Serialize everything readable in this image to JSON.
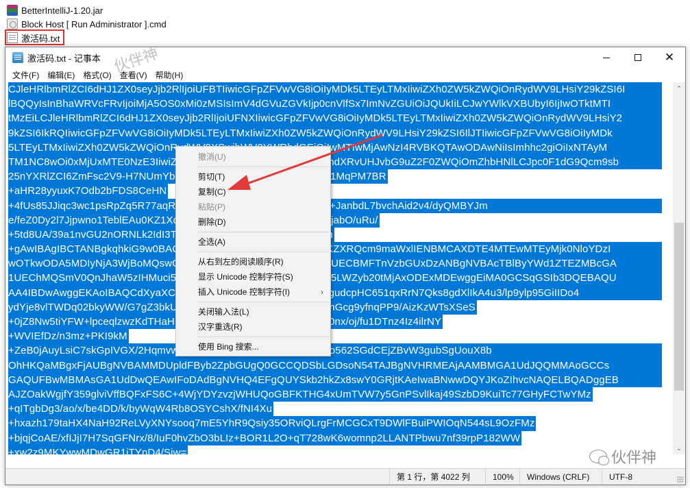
{
  "explorer": {
    "files": [
      {
        "name": "BetterIntelliJ-1.20.jar",
        "icon": "winrar-archive-icon"
      },
      {
        "name": "Block Host [ Run Administrator ].cmd",
        "icon": "cmd-script-icon"
      },
      {
        "name": "激活码.txt",
        "icon": "text-file-icon",
        "highlighted": true
      }
    ]
  },
  "window": {
    "title": "激活码.txt - 记事本",
    "controls": {
      "minimize": "—",
      "maximize": "□",
      "close": "✕"
    }
  },
  "menubar": {
    "items": [
      "文件(F)",
      "编辑(E)",
      "格式(O)",
      "查看(V)",
      "帮助(H)"
    ]
  },
  "editor": {
    "selection_color": "#0078d7",
    "lines": [
      {
        "text": "CJleHRlbmRlZCI6dHJ1ZX0seyJjb2RlIjoiUFBTIiwicGFpZFVwVG8iOiIyMDk5LTEyLTMxIiwiZXh0ZW5kZWQiOnRydWV9LHsiY29kZSI6I",
        "full": true
      },
      {
        "text": "lBQQyIsInBhaWRVcFRvIjoiMjA5OS0xMi0zMSIsImV4dGVuZGVkIjp0cnVlfSx7ImNvZGUiOiJQUkIiLCJwYWlkVXBUbyI6IjIwOTktMTI",
        "full": true
      },
      {
        "text": "tMzEiLCJleHRlbmRlZCI6dHJ1ZX0seyJjb2RlIjoiUFNXIiwicGFpZFVwVG8iOiIyMDk5LTEyLTMxIiwiZXh0ZW5kZWQiOnRydWV9LHsiY2",
        "full": true
      },
      {
        "text": "9kZSI6IkRQIiwicGFpZFVwVG8iOiIyMDk5LTEyLTMxIiwiZXh0ZW5kZWQiOnRydWV9LHsiY29kZSI6IlJTIiwicGFpZFVwVG8iOiIyMDk",
        "full": true
      },
      {
        "text": "5LTEyLTMxIiwiZXh0ZW5kZWQiOnRydWV9XSwibWV0YWRhdGEiOiIwMTIwMjAwNzI4RVBKQTAwODAwNiIsImhhc2giOiIxNTAyM",
        "full": true
      },
      {
        "text": "TM1NC8wOi0xMjUxMTE0NzE3IiwiZ3JhY2VQZXJpb2REYXlzIjo3LCJhdXRvUHJvbG9uZ2F0ZWQiOmZhbHNlLCJpc0F1dG9Qcm9sb",
        "full": true
      },
      {
        "text": "25nYXRlZCI6ZmFsc2V9-H7NUmYbCHmnL7yQQ0jeIYWPk/HViNdMg1MqPM7BR",
        "full": false
      },
      {
        "text": "+aHR28yyuxK7Odb2bFDS8CeHN",
        "full": false
      },
      {
        "text": "+4fUs85JJiqc3wc1psRpZq5R77aqRXo9IPUm1f2O1+kLBxrOkdqPpv9+JanbdL7bvchAid2v4/dyQMBYJm",
        "full": true
      },
      {
        "text": "e/feZ0Dy2l7Jjpwno1TeblEAu0KZ1Xd9ETLhnw1qL904/uPnGftjxWYluLjabO/uRu/",
        "full": false
      },
      {
        "text": "+5td8UA/39a1nvGU2nORNLk2IdI3TIv7ugtkw0E3Jpkw==-MIIDlzCCAn",
        "full": false
      },
      {
        "text": "+gAwIBAgIBCTANBgkqhkiG9w0BAQsFADAYMRYwFAYDVQQDDA1KZXRQcm9maWxlIENBMCAXDTE4MTEwMTEyMjk0NloYDzI",
        "full": true
      },
      {
        "text": "wOTkwODA5MDIyNjA3WjBoMQswCQYDVQQGEwJDWjEOMAwGA1UECBMFTnVzbGUxDzANBgNVBAcTBlByYWd1ZTEZMBcGA",
        "full": true
      },
      {
        "text": "1UEChMQSmV0QnJhaW5zIHMuci5vLjEdMBsGA1UEAxMUcHJvZDN5LWZyb20tMjAxODExMDEwggEiMA0GCSqGSIb3DQEBAQU",
        "full": true
      },
      {
        "text": "AA4IBDwAwggEKAoIBAQCdXyaXC8iRXaHVlSrGUZdnNo3M3gNnq7gudcpHC651qxRrN7Qks8gdXlIkA4u3/lp9ylp95GiIIDo4",
        "full": true
      },
      {
        "text": "ydYje8vlTWDq02bkyWW/G7gZ3bkUc5Ux5CfTRMjKkPkfD/+jffkfNfdGmGcg9yfnqPP9/AizKzWTsXSeS",
        "full": false
      },
      {
        "text": "+0jZ8Nw5tiYFW+lpceqlzwzKdTHaHhC7YzrvLg4Amu0I48ETAcch/ztt00nx/oj/fu1DTnz4Iz4ilrNY",
        "full": false
      },
      {
        "text": "+WVIEfDz/n3mz+PKI9kM",
        "full": false
      },
      {
        "text": "+ZeB0jAuyLsiC7skGpIVGX/2HqmvwZkwgZYwSAYDVR0jBEEwP4AUo562SGdCEjZBvW3gubSgUouX8b",
        "full": true
      },
      {
        "text": "OhHKQaMBgxFjAUBgNVBAMMDUpldFByb2ZpbGUgQ0GCCQDSbLGDsoN54TAJBgNVHRMEAjAAMBMGA1UdJQQMMAoGCCs",
        "full": true
      },
      {
        "text": "GAQUFBwMBMAsGA1UdDwQEAwIFoDAdBgNVHQ4EFgQUYSkb2hkZx8swY0GRjtKAeIwaBNwwDQYJKoZIhvcNAQELBQADggEB",
        "full": true
      },
      {
        "text": "AJZOakWgjfY359glviVffBQFxFS6C+4WjYDYzvzjWHUQoGBFKTHG4xUmTVW7y5GnPSvlIkaj49SzbD9KuiTc77GHyFCTwYMz",
        "full": false
      },
      {
        "text": "+qITgbDg3/ao/x/be4DD/k/byWqW4Rb8OSYCshX/fNI4Xu",
        "full": false
      },
      {
        "text": "+hxazh179taHX4NaH92ReLVyXNYsooq7mE5YhR9Qsiy35ORviQLrgFrMCGCxT9DWlFBuiPWIOqN544sL9OzFMz",
        "full": false
      },
      {
        "text": "+bjqjCoAE/xfIJjI7H7SqGFNrx/8/IuF0hvZbO3bLIz+BOR1L2O+qT728wK6womnp2LLANTPbwu7nf39rpP182WW",
        "full": false
      },
      {
        "text": "+xw2z9MKYwwMDwGR1iTYnD4/Sjw=",
        "full": false
      }
    ]
  },
  "context_menu": {
    "groups": [
      [
        {
          "label": "撤消(U)",
          "enabled": false
        }
      ],
      [
        {
          "label": "剪切(T)",
          "enabled": true
        },
        {
          "label": "复制(C)",
          "enabled": true
        },
        {
          "label": "粘贴(P)",
          "enabled": false
        },
        {
          "label": "删除(D)",
          "enabled": true
        }
      ],
      [
        {
          "label": "全选(A)",
          "enabled": true
        }
      ],
      [
        {
          "label": "从右到左的阅读顺序(R)",
          "enabled": true
        },
        {
          "label": "显示 Unicode 控制字符(S)",
          "enabled": true
        },
        {
          "label": "插入 Unicode 控制字符(I)",
          "enabled": true,
          "submenu": true
        }
      ],
      [
        {
          "label": "关闭输入法(L)",
          "enabled": true
        },
        {
          "label": "汉字重选(R)",
          "enabled": true
        }
      ],
      [
        {
          "label": "使用 Bing 搜索...",
          "enabled": true
        }
      ]
    ],
    "submenu_glyph": "›"
  },
  "statusbar": {
    "position": "第 1 行，第 4022 列",
    "zoom": "100%",
    "line_ending": "Windows (CRLF)",
    "encoding": "UTF-8"
  },
  "scrollbar": {
    "up": "⌃",
    "down": "⌄"
  },
  "annotation": {
    "arrow_color": "#e23a3a",
    "highlight_color": "#e03030"
  },
  "watermark": {
    "text": "伙伴神",
    "top_text": "伙伴神"
  }
}
